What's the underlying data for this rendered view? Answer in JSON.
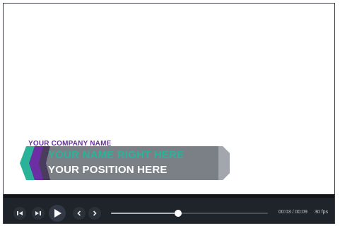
{
  "lower_third": {
    "company": "YOUR COMPANY NAME",
    "name": "YOUR NAME RIGHT HERE",
    "position": "YOUR POSITION HERE",
    "colors": {
      "purple": "#6b2fa3",
      "teal": "#2bb39a",
      "bar": "#7b7f86"
    }
  },
  "controls": {
    "icons": [
      "step-back-icon",
      "step-forward-icon",
      "play-icon",
      "prev-frame-icon",
      "next-frame-icon"
    ],
    "progress": 0.43,
    "time": "00:03 / 00:09",
    "fps": "30 fps"
  }
}
